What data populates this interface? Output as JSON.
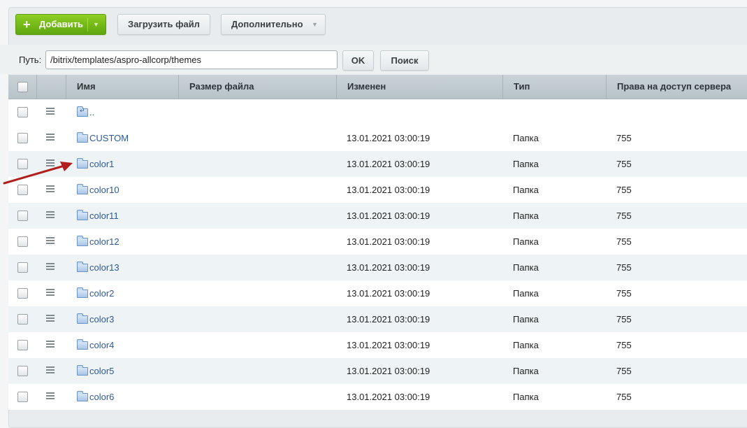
{
  "toolbar": {
    "add_label": "Добавить",
    "upload_label": "Загрузить файл",
    "more_label": "Дополнительно"
  },
  "path": {
    "label": "Путь:",
    "value": "/bitrix/templates/aspro-allcorp/themes",
    "ok_label": "OK",
    "search_label": "Поиск"
  },
  "table": {
    "columns": {
      "name": "Имя",
      "size": "Размер файла",
      "modified": "Изменен",
      "type": "Тип",
      "rights": "Права на доступ сервера"
    },
    "rows": [
      {
        "name": "..",
        "modified": "",
        "type": "",
        "rights": ""
      },
      {
        "name": "CUSTOM",
        "modified": "13.01.2021 03:00:19",
        "type": "Папка",
        "rights": "755"
      },
      {
        "name": "color1",
        "modified": "13.01.2021 03:00:19",
        "type": "Папка",
        "rights": "755"
      },
      {
        "name": "color10",
        "modified": "13.01.2021 03:00:19",
        "type": "Папка",
        "rights": "755"
      },
      {
        "name": "color11",
        "modified": "13.01.2021 03:00:19",
        "type": "Папка",
        "rights": "755"
      },
      {
        "name": "color12",
        "modified": "13.01.2021 03:00:19",
        "type": "Папка",
        "rights": "755"
      },
      {
        "name": "color13",
        "modified": "13.01.2021 03:00:19",
        "type": "Папка",
        "rights": "755"
      },
      {
        "name": "color2",
        "modified": "13.01.2021 03:00:19",
        "type": "Папка",
        "rights": "755"
      },
      {
        "name": "color3",
        "modified": "13.01.2021 03:00:19",
        "type": "Папка",
        "rights": "755"
      },
      {
        "name": "color4",
        "modified": "13.01.2021 03:00:19",
        "type": "Папка",
        "rights": "755"
      },
      {
        "name": "color5",
        "modified": "13.01.2021 03:00:19",
        "type": "Папка",
        "rights": "755"
      },
      {
        "name": "color6",
        "modified": "13.01.2021 03:00:19",
        "type": "Папка",
        "rights": "755"
      }
    ]
  },
  "colors": {
    "add_button": "#6cb514",
    "link": "#2a5a9c",
    "arrow": "#b01e1e"
  }
}
